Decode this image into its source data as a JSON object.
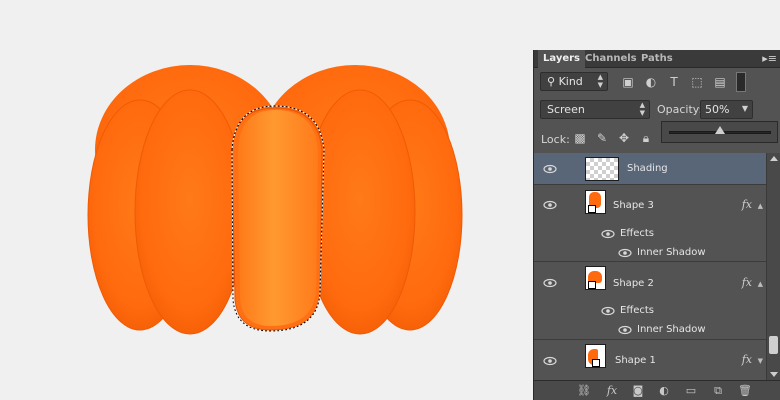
{
  "tabs": [
    {
      "label": "Layers",
      "active": true
    },
    {
      "label": "Channels",
      "active": false
    },
    {
      "label": "Paths",
      "active": false
    }
  ],
  "filter": {
    "kind_label": "Kind",
    "icons": [
      "image-filter-icon",
      "adjustment-filter-icon",
      "type-filter-icon",
      "shape-filter-icon",
      "smart-object-filter-icon",
      "filter-toggle-icon"
    ]
  },
  "blend": {
    "mode": "Screen",
    "opacity_label": "Opacity:",
    "opacity_value": "50%",
    "opacity_fraction": 0.5
  },
  "lock": {
    "label": "Lock:",
    "icons": [
      "lock-transparent-icon",
      "lock-image-icon",
      "lock-position-icon",
      "lock-all-icon"
    ]
  },
  "layers": [
    {
      "name": "Shading",
      "selected": true,
      "has_fx": false
    },
    {
      "name": "Shape 3",
      "selected": false,
      "has_fx": true,
      "effects_label": "Effects",
      "effect": "Inner Shadow"
    },
    {
      "name": "Shape 2",
      "selected": false,
      "has_fx": true,
      "effects_label": "Effects",
      "effect": "Inner Shadow"
    },
    {
      "name": "Shape 1",
      "selected": false,
      "has_fx": true
    }
  ],
  "footer_icons": [
    "link-layers-icon",
    "add-style-icon",
    "add-mask-icon",
    "new-adjustment-icon",
    "new-group-icon",
    "new-layer-icon",
    "delete-layer-icon"
  ],
  "colors": {
    "pumpkin": "#ff6a0e",
    "highlight": "#ff8a24",
    "selected_layer": "#596678",
    "panel": "#535353"
  }
}
